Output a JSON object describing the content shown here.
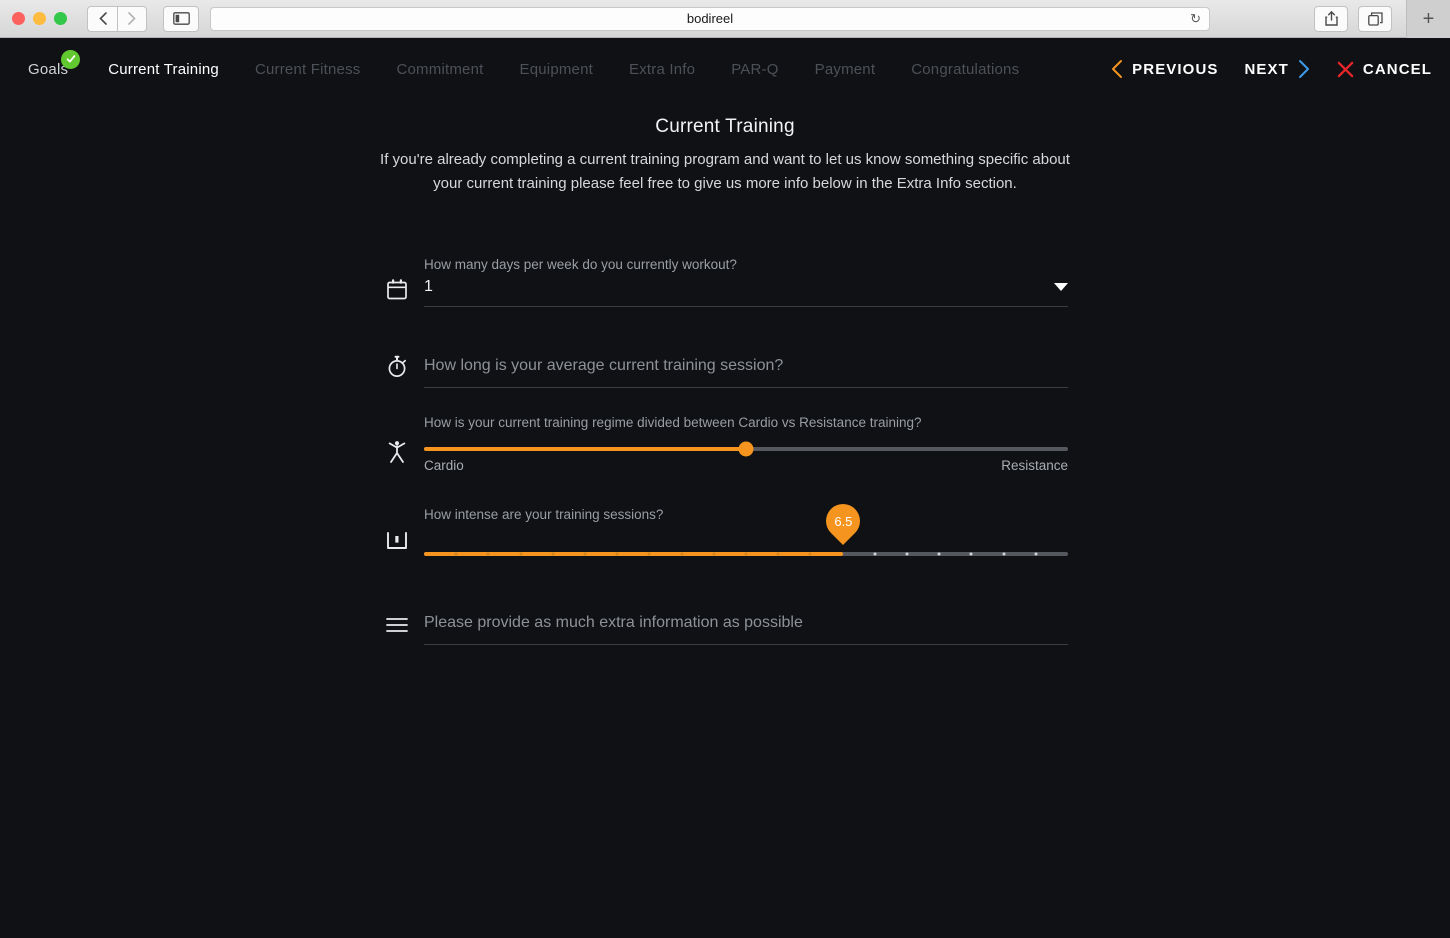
{
  "browser": {
    "title": "bodireel",
    "back_icon": "chevron-left-icon",
    "forward_icon": "chevron-right-icon",
    "sidebar_icon": "sidebar-icon",
    "reload_icon": "reload-icon",
    "share_icon": "share-icon",
    "tabs_icon": "tabs-icon",
    "new_tab_label": "+"
  },
  "steps": [
    {
      "label": "Goals",
      "state": "done"
    },
    {
      "label": "Current Training",
      "state": "active"
    },
    {
      "label": "Current Fitness",
      "state": "upcoming"
    },
    {
      "label": "Commitment",
      "state": "upcoming"
    },
    {
      "label": "Equipment",
      "state": "upcoming"
    },
    {
      "label": "Extra Info",
      "state": "upcoming"
    },
    {
      "label": "PAR-Q",
      "state": "upcoming"
    },
    {
      "label": "Payment",
      "state": "upcoming"
    },
    {
      "label": "Congratulations",
      "state": "upcoming"
    }
  ],
  "nav": {
    "previous_label": "PREVIOUS",
    "next_label": "NEXT",
    "cancel_label": "CANCEL",
    "previous_color": "#f5941f",
    "next_color": "#3d9ae8",
    "cancel_color": "#e8262a"
  },
  "page": {
    "title": "Current Training",
    "description": "If you're already completing a current training program and want to let us know something specific about your current training please feel free to give us more info below in the Extra Info section."
  },
  "fields": {
    "days_per_week": {
      "icon": "calendar-icon",
      "label": "How many days per week do you currently workout?",
      "value": "1"
    },
    "session_length": {
      "icon": "stopwatch-icon",
      "placeholder": "How long is your average current training session?"
    },
    "cardio_resistance": {
      "icon": "person-icon",
      "label": "How is your current training regime divided between Cardio vs Resistance training?",
      "left_label": "Cardio",
      "right_label": "Resistance",
      "percent": 50
    },
    "intensity": {
      "icon": "bar-chart-icon",
      "label": "How intense are your training sessions?",
      "value": "6.5",
      "min": 0,
      "max": 10,
      "step": 0.5,
      "percent": 65
    },
    "extra_info": {
      "icon": "menu-lines-icon",
      "placeholder": "Please provide as much extra information as possible"
    }
  },
  "colors": {
    "background": "#0f1114",
    "accent": "#f5941f",
    "check_green": "#61c92f"
  }
}
